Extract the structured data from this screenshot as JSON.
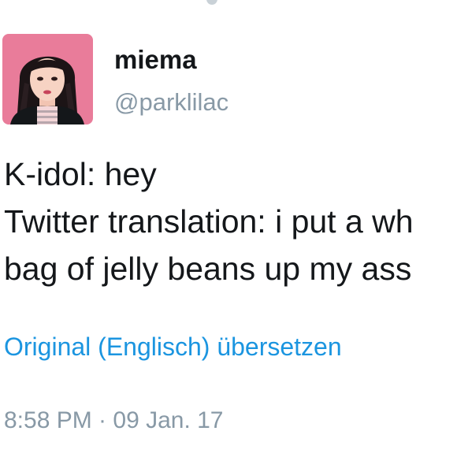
{
  "user": {
    "display_name": "miema",
    "handle": "@parklilac"
  },
  "tweet": {
    "lines": [
      "K-idol: hey",
      "Twitter translation: i put a wh",
      "bag of jelly beans up my ass"
    ],
    "translate_link": "Original (Englisch) übersetzen",
    "timestamp": "8:58 PM · 09 Jan. 17"
  },
  "colors": {
    "link": "#1b95e0",
    "muted": "#8899a6",
    "text": "#14171a",
    "avatar_background": "#e97c9a"
  },
  "icons": {
    "avatar": "profile-photo"
  }
}
